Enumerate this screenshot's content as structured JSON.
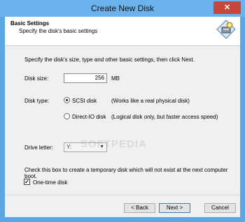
{
  "window": {
    "title": "Create New Disk",
    "close_symbol": "✕"
  },
  "header": {
    "title": "Basic Settings",
    "subtitle": "Specify the disk's basic settings",
    "icon": "disk-wizard-icon"
  },
  "intro_text": "Specify the disk's size, type and other basic settings, then click Next.",
  "disk_size": {
    "label": "Disk size:",
    "value": "256",
    "unit": "MB"
  },
  "disk_type": {
    "label": "Disk type:",
    "options": [
      {
        "label": "SCSI disk",
        "description": "(Works like a real physical disk)",
        "selected": true
      },
      {
        "label": "Direct-IO disk",
        "description": "(Logical disk only, but faster access speed)",
        "selected": false
      }
    ]
  },
  "drive_letter": {
    "label": "Drive letter:",
    "value": "Y:"
  },
  "temporary": {
    "note": "Check this box to create a temporary disk which will not exist at the next computer boot.",
    "checkbox_label": "One-time disk",
    "checked": true,
    "check_mark": "✓"
  },
  "buttons": {
    "back": "< Back",
    "next": "Next >",
    "cancel": "Cancel"
  },
  "watermark": "SOFTPEDIA",
  "colors": {
    "title_bar": "#6cb2ec",
    "close_button": "#c7473a",
    "dialog_bg": "#f0f0f0"
  }
}
